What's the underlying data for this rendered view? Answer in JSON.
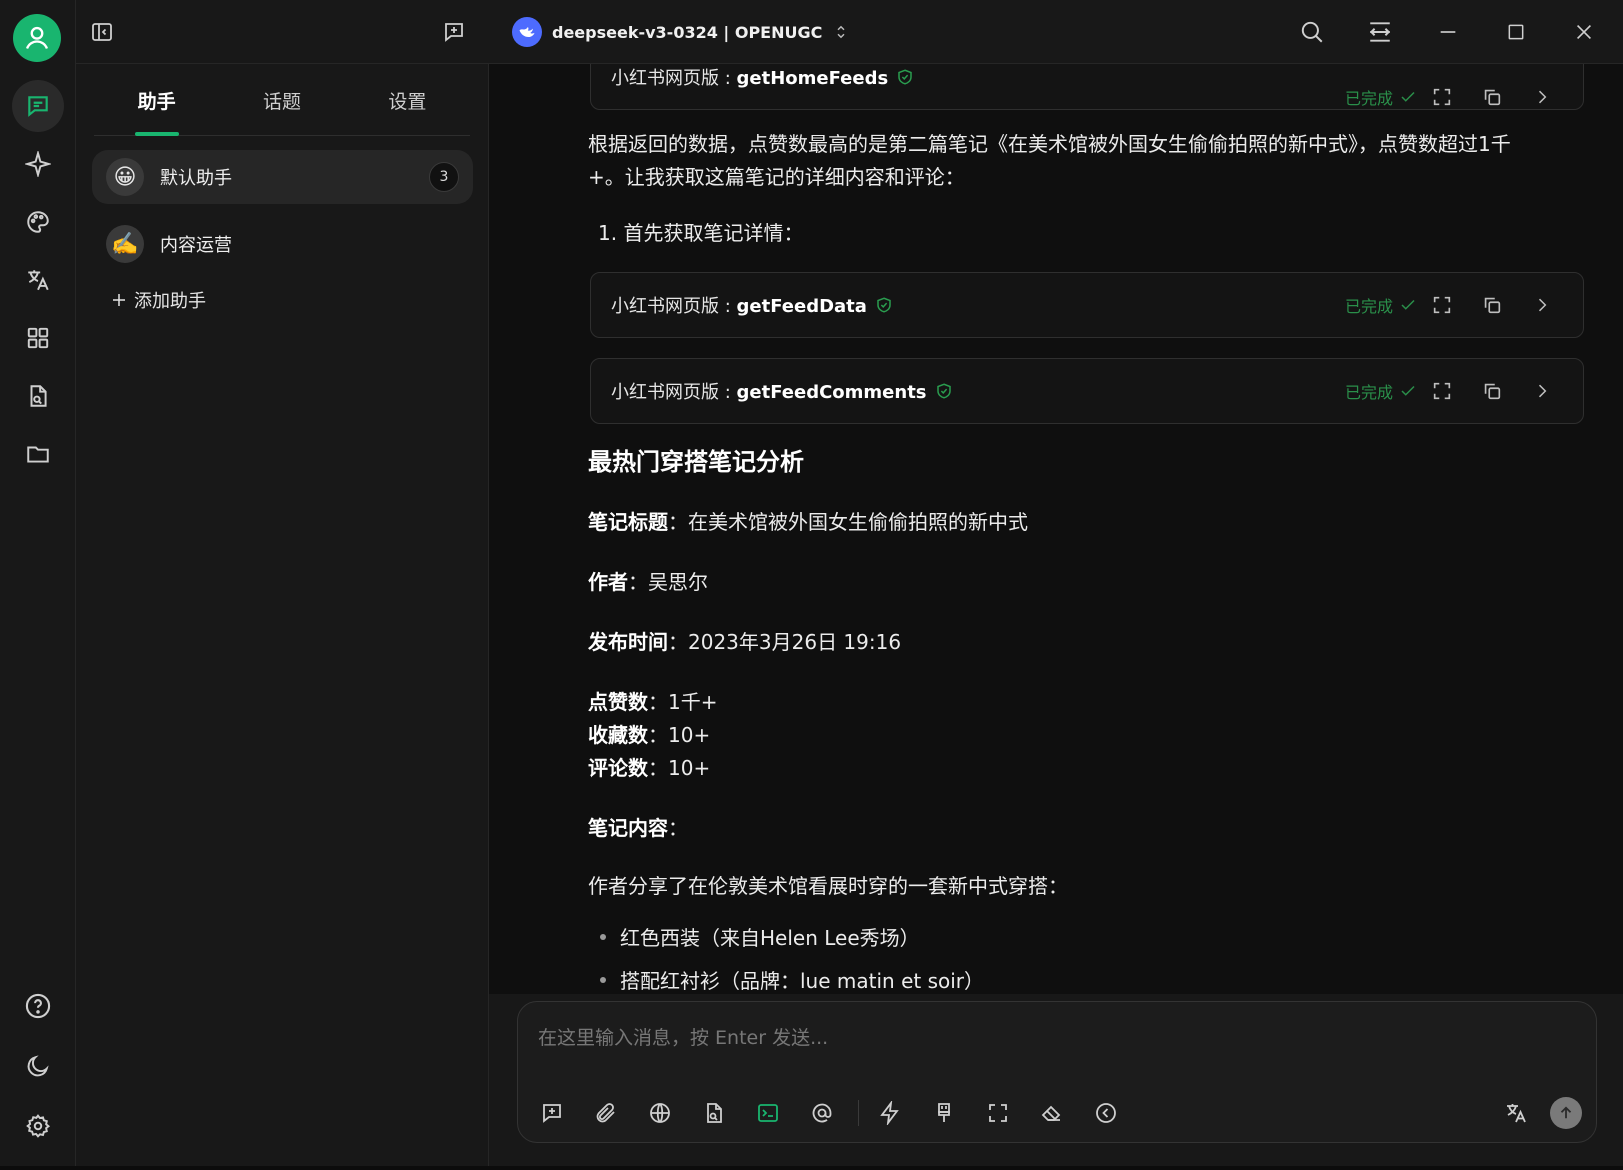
{
  "titlebar": {
    "model_label": "deepseek-v3-0324 | OPENUGC"
  },
  "panel": {
    "tabs": [
      {
        "label": "助手"
      },
      {
        "label": "话题"
      },
      {
        "label": "设置"
      }
    ],
    "assistants": [
      {
        "emoji": "😀",
        "name": "默认助手",
        "badge": "3"
      },
      {
        "emoji": "✍️",
        "name": "内容运营"
      }
    ],
    "add_label": "添加助手"
  },
  "chat": {
    "tools": [
      {
        "prefix": "小红书网页版 : ",
        "name": "getHomeFeeds",
        "status": "已完成"
      },
      {
        "prefix": "小红书网页版 : ",
        "name": "getFeedData",
        "status": "已完成"
      },
      {
        "prefix": "小红书网页版 : ",
        "name": "getFeedComments",
        "status": "已完成"
      }
    ],
    "intro_line1": "根据返回的数据，点赞数最高的是第二篇笔记《在美术馆被外国女生偷偷拍照的新中式》，点赞数超过1千",
    "intro_line2": "+。让我获取这篇笔记的详细内容和评论：",
    "step1": "1. 首先获取笔记详情：",
    "section_title": "最热门穿搭笔记分析",
    "fields": [
      {
        "key": "笔记标题",
        "value": "在美术馆被外国女生偷偷拍照的新中式"
      },
      {
        "key": "作者",
        "value": "吴思尔"
      },
      {
        "key": "发布时间",
        "value": "2023年3月26日 19:16"
      },
      {
        "key": "点赞数",
        "value": "1千+"
      },
      {
        "key": "收藏数",
        "value": "10+"
      },
      {
        "key": "评论数",
        "value": "10+"
      },
      {
        "key": "笔记内容",
        "value": ""
      }
    ],
    "content_intro": "作者分享了在伦敦美术馆看展时穿的一套新中式穿搭：",
    "bullets": [
      "红色西装（来自Helen Lee秀场）",
      "搭配红衬衫（品牌：lue matin et soir）"
    ]
  },
  "composer": {
    "placeholder": "在这里输入消息，按 Enter 发送..."
  },
  "colors": {
    "accent": "#19b56f",
    "status_green": "#2a8f4a",
    "model_logo": "#4d6bfe"
  }
}
